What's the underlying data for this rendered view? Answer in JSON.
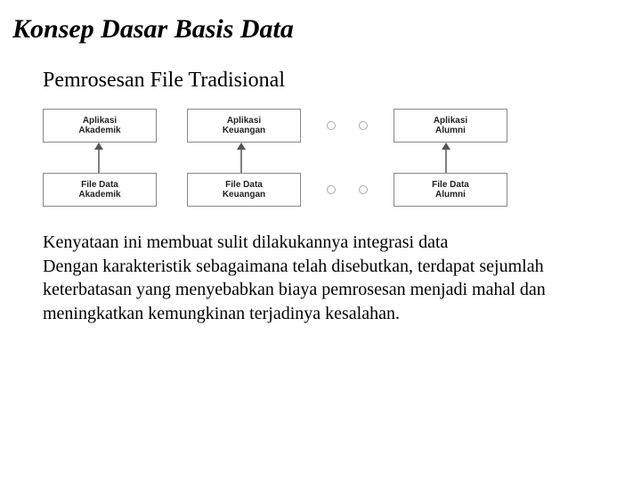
{
  "title": "Konsep Dasar Basis Data",
  "subtitle": "Pemrosesan File Tradisional",
  "diagram": {
    "top": [
      {
        "l1": "Aplikasi",
        "l2": "Akademik"
      },
      {
        "l1": "Aplikasi",
        "l2": "Keuangan"
      },
      {
        "l1": "Aplikasi",
        "l2": "Alumni"
      }
    ],
    "bottom": [
      {
        "l1": "File Data",
        "l2": "Akademik"
      },
      {
        "l1": "File Data",
        "l2": "Keuangan"
      },
      {
        "l1": "File Data",
        "l2": "Alumni"
      }
    ]
  },
  "paragraph1": "Kenyataan ini membuat sulit dilakukannya integrasi data",
  "paragraph2": "Dengan karakteristik sebagaimana telah disebutkan, terdapat sejumlah keterbatasan yang menyebabkan  biaya pemrosesan menjadi mahal dan meningkatkan kemungkinan terjadinya kesalahan."
}
